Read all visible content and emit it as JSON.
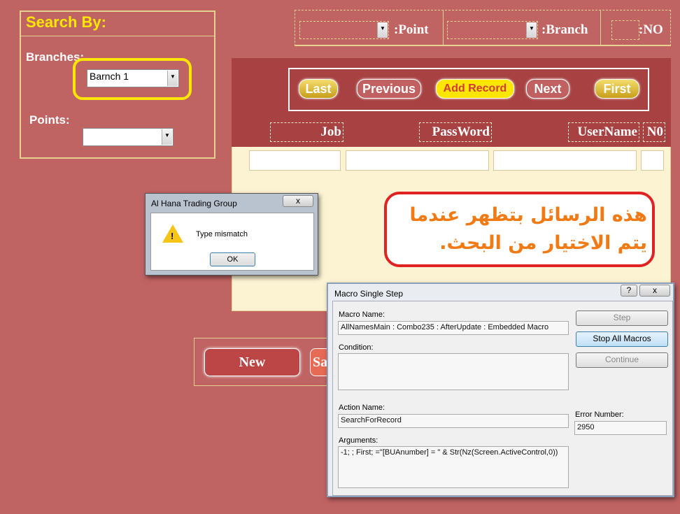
{
  "search_panel": {
    "title": "Search By:",
    "branches_label": "Branches:",
    "branch_value": "Barnch 1",
    "points_label": "Points:",
    "points_value": ""
  },
  "top_filters": {
    "point_label": ":Point",
    "branch_label": ":Branch",
    "no_label": ":NO"
  },
  "nav": {
    "last": "Last",
    "previous": "Previous",
    "add_record": "Add Record",
    "next": "Next",
    "first": "First"
  },
  "columns": {
    "job": "Job",
    "password": "PassWord",
    "username": "UserName",
    "no": "N0"
  },
  "bottom_buttons": {
    "new": "New",
    "save_partial": "Sa"
  },
  "annotation": {
    "text": "هذه الرسائل بتظهر عندما يتم الاختيار من البحث."
  },
  "msgbox": {
    "title": "Al Hana Trading Group",
    "message": "Type mismatch",
    "ok": "OK",
    "close": "x"
  },
  "macro": {
    "title": "Macro Single Step",
    "help": "?",
    "close": "x",
    "macro_name_label": "Macro Name:",
    "macro_name_value": "AllNamesMain : Combo235 : AfterUpdate : Embedded Macro",
    "condition_label": "Condition:",
    "condition_value": "",
    "action_name_label": "Action Name:",
    "action_name_value": "SearchForRecord",
    "arguments_label": "Arguments:",
    "arguments_value": "-1; ; First; =\"[BUAnumber] = \" & Str(Nz(Screen.ActiveControl,0))",
    "step": "Step",
    "stop_all": "Stop All Macros",
    "continue": "Continue",
    "error_number_label": "Error Number:",
    "error_number_value": "2950"
  }
}
